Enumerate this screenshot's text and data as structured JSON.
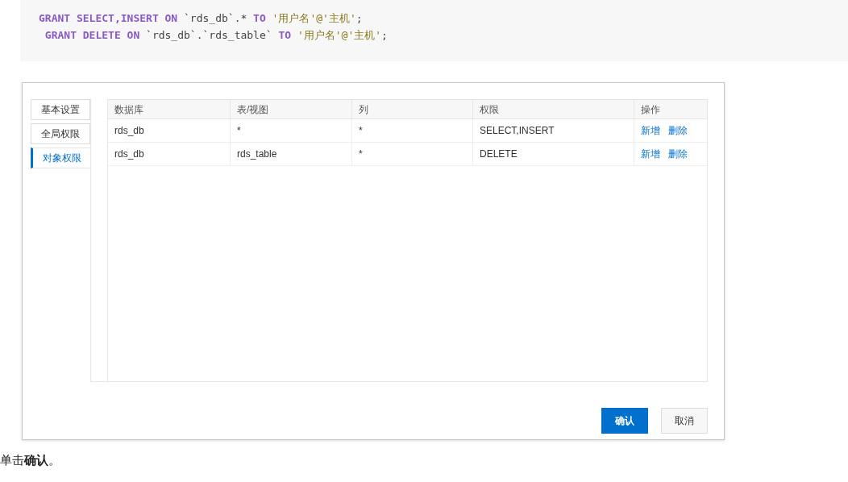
{
  "code_lines": [
    [
      {
        "kind": "keyword",
        "text": "GRANT SELECT,INSERT ON "
      },
      {
        "kind": "plain",
        "text": "`rds_db`.* "
      },
      {
        "kind": "keyword",
        "text": "TO "
      },
      {
        "kind": "string",
        "text": "'用户名'@'主机'"
      },
      {
        "kind": "plain",
        "text": ";"
      }
    ],
    [
      {
        "kind": "keyword",
        "text": " GRANT DELETE ON "
      },
      {
        "kind": "plain",
        "text": "`rds_db`.`rds_table` "
      },
      {
        "kind": "keyword",
        "text": "TO "
      },
      {
        "kind": "string",
        "text": "'用户名'@'主机'"
      },
      {
        "kind": "plain",
        "text": ";"
      }
    ]
  ],
  "dialog": {
    "tabs": [
      {
        "label": "基本设置",
        "selected": false
      },
      {
        "label": "全局权限",
        "selected": false
      },
      {
        "label": "对象权限",
        "selected": true
      }
    ],
    "table": {
      "columns": [
        "数据库",
        "表/视图",
        "列",
        "权限",
        "操作"
      ],
      "rows": [
        {
          "cells": [
            "rds_db",
            "*",
            "*",
            "SELECT,INSERT"
          ],
          "actions": [
            "新增",
            "删除"
          ]
        },
        {
          "cells": [
            "rds_db",
            "rds_table",
            "*",
            "DELETE"
          ],
          "actions": [
            "新增",
            "删除"
          ]
        }
      ]
    },
    "buttons": [
      {
        "label": "确认",
        "kind": "primary"
      },
      {
        "label": "取消",
        "kind": "secondary"
      }
    ]
  },
  "instruction": "单击**确认**。"
}
